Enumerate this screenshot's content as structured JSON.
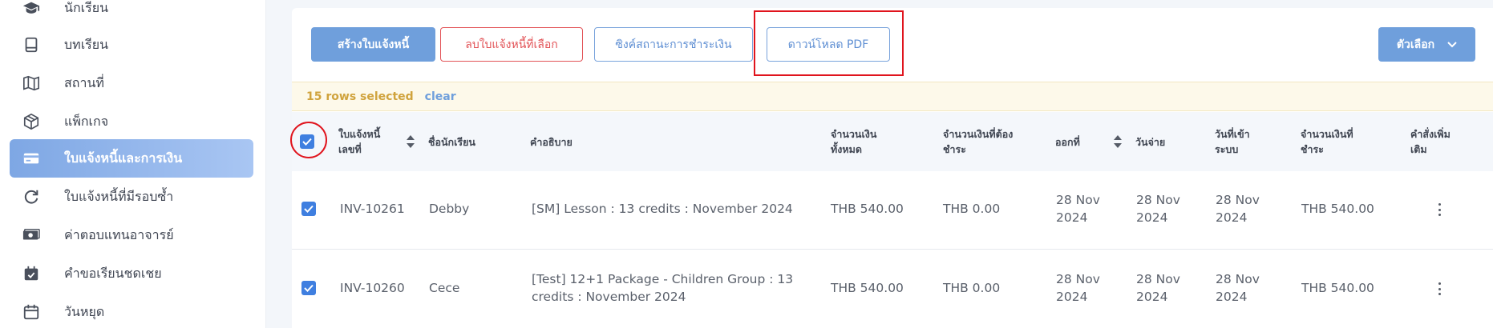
{
  "sidebar": {
    "items": [
      {
        "label": "นักเรียน",
        "icon": "graduation-cap-icon"
      },
      {
        "label": "บทเรียน",
        "icon": "book-icon"
      },
      {
        "label": "สถานที่",
        "icon": "map-icon"
      },
      {
        "label": "แพ็กเกจ",
        "icon": "package-icon"
      },
      {
        "label": "ใบแจ้งหนี้และการเงิน",
        "icon": "credit-card-icon",
        "active": true
      },
      {
        "label": "ใบแจ้งหนี้ที่มีรอบซ้ำ",
        "icon": "recurring-icon"
      },
      {
        "label": "ค่าตอบแทนอาจารย์",
        "icon": "money-icon"
      },
      {
        "label": "คำขอเรียนชดเชย",
        "icon": "calendar-check-icon"
      },
      {
        "label": "วันหยุด",
        "icon": "calendar-icon"
      }
    ]
  },
  "toolbar": {
    "create_invoice": "สร้างใบแจ้งหนี้",
    "delete_selected": "ลบใบแจ้งหนี้ที่เลือก",
    "sync_payment": "ซิงค์สถานะการชำระเงิน",
    "download_pdf": "ดาวน์โหลด PDF",
    "options": "ตัวเลือก"
  },
  "selection": {
    "count_text": "15 rows selected",
    "clear": "clear"
  },
  "table": {
    "headers": {
      "invoice_no": "ใบแจ้งหนี้\nเลขที่",
      "student_name": "ชื่อนักเรียน",
      "description": "คำอธิบาย",
      "total_amount": "จำนวนเงิน\nทั้งหมด",
      "amount_due": "จำนวนเงินที่ต้อง\nชำระ",
      "issued": "ออกที่",
      "due_date": "วันจ่าย",
      "created": "วันที่เข้า\nระบบ",
      "amount_paid": "จำนวนเงินที่\nชำระ",
      "more": "คำสั่งเพิ่ม\nเติม"
    },
    "rows": [
      {
        "invoice_no": "INV-10261",
        "student": "Debby",
        "description": "[SM] Lesson : 13 credits : November 2024",
        "total": "THB 540.00",
        "due": "THB 0.00",
        "issued": "28 Nov\n2024",
        "due_date": "28 Nov\n2024",
        "created": "28 Nov\n2024",
        "paid": "THB 540.00"
      },
      {
        "invoice_no": "INV-10260",
        "student": "Cece",
        "description": "[Test] 12+1 Package - Children Group : 13\ncredits : November 2024",
        "total": "THB 540.00",
        "due": "THB 0.00",
        "issued": "28 Nov\n2024",
        "due_date": "28 Nov\n2024",
        "created": "28 Nov\n2024",
        "paid": "THB 540.00"
      }
    ]
  },
  "colors": {
    "primary": "#6f9fdc",
    "danger": "#e25357",
    "highlight": "#e0141d",
    "checkbox": "#3f7fe0"
  }
}
